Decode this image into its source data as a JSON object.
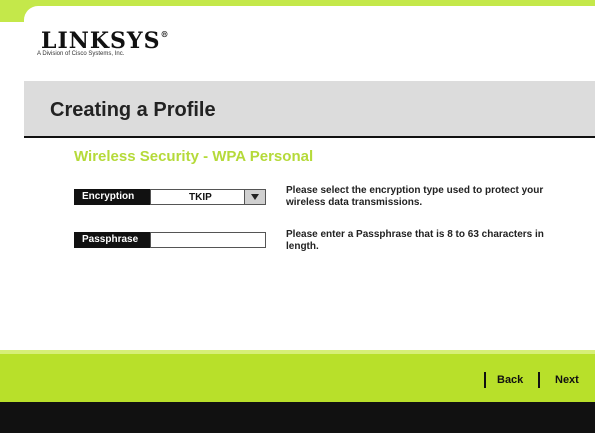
{
  "brand": {
    "logo_text": "LINKSYS",
    "logo_mark": "®",
    "tagline": "A Division of Cisco Systems, Inc."
  },
  "header": {
    "title": "Creating a Profile"
  },
  "section": {
    "title": "Wireless Security - WPA Personal"
  },
  "encryption": {
    "label": "Encryption",
    "selected": "TKIP",
    "help": "Please select the encryption type used to protect your wireless data transmissions."
  },
  "passphrase": {
    "label": "Passphrase",
    "value": "",
    "help": "Please enter a Passphrase that is 8 to 63 characters in length."
  },
  "nav": {
    "back_label": "Back",
    "next_label": "Next"
  },
  "colors": {
    "accent_green": "#b8e02a",
    "section_green": "#b5da3a",
    "dark": "#111111"
  }
}
